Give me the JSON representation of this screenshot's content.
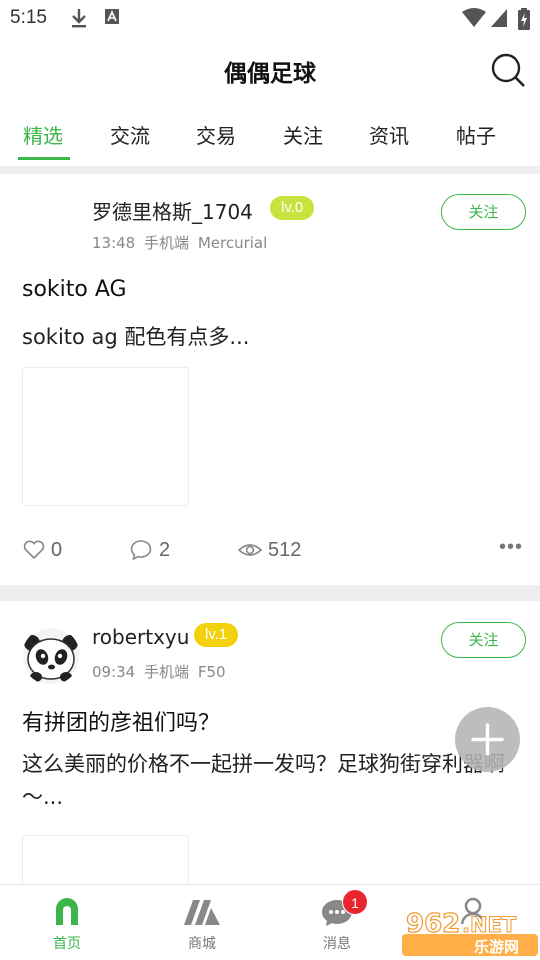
{
  "status_bar": {
    "time": "5:15"
  },
  "header": {
    "title": "偶偶足球"
  },
  "tabs": [
    {
      "label": "精选",
      "active": true
    },
    {
      "label": "交流",
      "active": false
    },
    {
      "label": "交易",
      "active": false
    },
    {
      "label": "关注",
      "active": false
    },
    {
      "label": "资讯",
      "active": false
    },
    {
      "label": "帖子",
      "active": false
    }
  ],
  "posts": [
    {
      "username": "罗德里格斯_1704",
      "level": "lv.0",
      "level_color": "#c8e33f",
      "time": "13:48",
      "device": "手机端",
      "tag": "Mercurial",
      "follow_label": "关注",
      "title": "sokito AG",
      "body": "sokito ag 配色有点多...",
      "likes": "0",
      "comments": "2",
      "views": "512",
      "more": "•••"
    },
    {
      "username": "robertxyu",
      "level": "lv.1",
      "level_color": "#f2d20f",
      "time": "09:34",
      "device": "手机端",
      "tag": "F50",
      "follow_label": "关注",
      "title": "有拼团的彦祖们吗？",
      "body": "这么美丽的价格不一起拼一发吗？足球狗街穿利器啊～..."
    }
  ],
  "bottom_nav": [
    {
      "label": "首页",
      "icon": "home-arch-icon",
      "active": true
    },
    {
      "label": "商城",
      "icon": "mall-icon",
      "active": false
    },
    {
      "label": "消息",
      "icon": "message-icon",
      "active": false,
      "badge": "1"
    },
    {
      "label": "",
      "icon": "profile-icon",
      "active": false
    }
  ],
  "watermark": {
    "brand": "962",
    "suffix": ".NET",
    "sub": "乐游网"
  },
  "colors": {
    "accent": "#3cb54a",
    "badge": "#e8262e"
  }
}
